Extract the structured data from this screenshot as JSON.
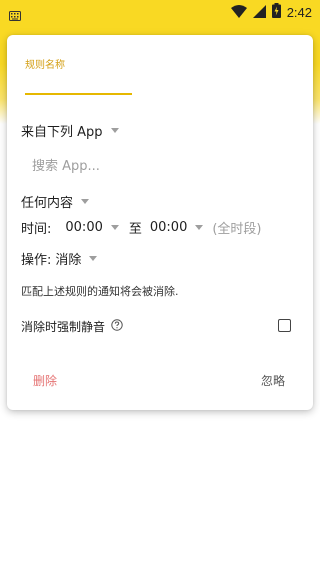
{
  "status_bar": {
    "time": "2:42",
    "icons": [
      "keyboard-icon",
      "wifi-icon",
      "signal-icon",
      "battery-charging-icon"
    ]
  },
  "dialog": {
    "rule_name_label": "规则名称",
    "rule_name_value": "",
    "app_selector_label": "来自下列 App",
    "app_search_placeholder": "搜索 App...",
    "content_selector_label": "任何内容",
    "time_label": "时间:",
    "time_start": "00:00",
    "time_to": "至",
    "time_end": "00:00",
    "time_hint": "(全时段)",
    "action_label": "操作:",
    "action_value": "消除",
    "action_note": "匹配上述规则的通知将会被消除.",
    "mute_label": "消除时强制静音",
    "mute_checked": false,
    "delete_button": "删除",
    "ignore_button": "忽略"
  },
  "colors": {
    "accent_yellow": "#f9d923",
    "label_gold": "#d4a017",
    "delete_red": "#e57373"
  }
}
